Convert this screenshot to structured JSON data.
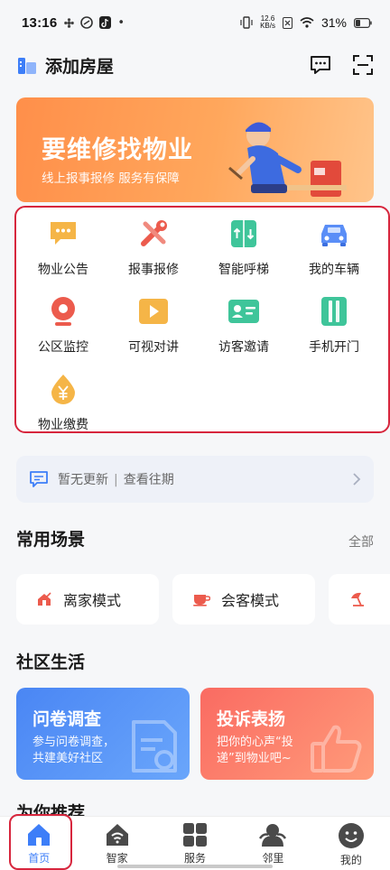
{
  "status_bar": {
    "time": "13:16",
    "net_speed_value": "12.6",
    "net_speed_unit": "KB/s",
    "battery": "31%"
  },
  "header": {
    "title": "添加房屋",
    "icons": [
      "building-icon",
      "message-icon",
      "scan-icon"
    ]
  },
  "banner": {
    "title": "要维修找物业",
    "subtitle": "线上报事报修 服务有保障"
  },
  "services": [
    {
      "label": "物业公告",
      "icon": "announcement-icon",
      "color": "#f5b547"
    },
    {
      "label": "报事报修",
      "icon": "repair-tools-icon",
      "color": "#ec5b4d"
    },
    {
      "label": "智能呼梯",
      "icon": "elevator-icon",
      "color": "#3fc59a"
    },
    {
      "label": "我的车辆",
      "icon": "car-icon",
      "color": "#5a8ef7"
    },
    {
      "label": "公区监控",
      "icon": "camera-icon",
      "color": "#ec5b4d"
    },
    {
      "label": "可视对讲",
      "icon": "video-play-icon",
      "color": "#f5b547"
    },
    {
      "label": "访客邀请",
      "icon": "visitor-card-icon",
      "color": "#3fc59a"
    },
    {
      "label": "手机开门",
      "icon": "door-icon",
      "color": "#3fc59a"
    },
    {
      "label": "物业缴费",
      "icon": "yuan-drop-icon",
      "color": "#f5b547"
    }
  ],
  "notice": {
    "text": "暂无更新",
    "separator": "|",
    "link": "查看往期"
  },
  "scenes": {
    "title": "常用场景",
    "more": "全部",
    "items": [
      {
        "label": "离家模式",
        "icon": "leave-home-icon"
      },
      {
        "label": "会客模式",
        "icon": "teacup-icon"
      },
      {
        "label": "",
        "icon": "umbrella-icon"
      }
    ]
  },
  "community": {
    "title": "社区生活",
    "cards": [
      {
        "title": "问卷调查",
        "line1": "参与问卷调查，",
        "line2": "共建美好社区",
        "color": "#4f8ff6"
      },
      {
        "title": "投诉表扬",
        "line1": "把你的心声“投",
        "line2": "递”到物业吧~",
        "color": "#fa7566"
      }
    ]
  },
  "peek_section": {
    "title": "为你推荐"
  },
  "tabbar": {
    "tabs": [
      {
        "label": "首页",
        "icon": "home-icon",
        "active": true
      },
      {
        "label": "智家",
        "icon": "smart-home-icon",
        "active": false
      },
      {
        "label": "服务",
        "icon": "grid-apps-icon",
        "active": false
      },
      {
        "label": "邻里",
        "icon": "neighbors-icon",
        "active": false
      },
      {
        "label": "我的",
        "icon": "profile-icon",
        "active": false
      }
    ]
  },
  "colors": {
    "accent": "#3d7ef8",
    "highlight": "#d7263d",
    "banner": "#ff9a52"
  }
}
